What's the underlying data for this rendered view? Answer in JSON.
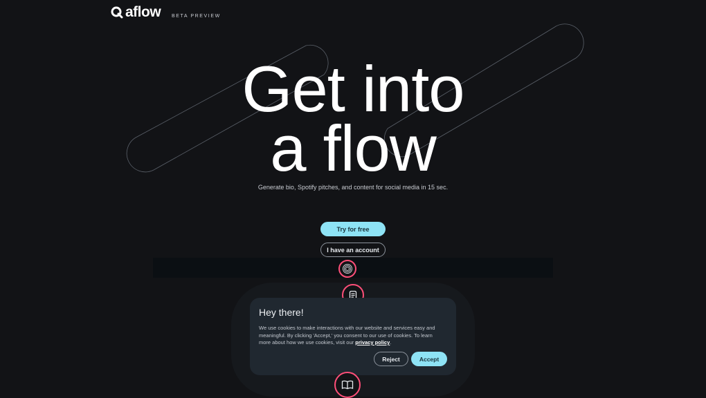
{
  "brand": {
    "name": "aflow",
    "badge": "BETA PREVIEW"
  },
  "hero": {
    "line1": "Get into",
    "line2": "a flow",
    "subtitle": "Generate bio, Spotify pitches, and content for social media in 15 sec."
  },
  "actions": {
    "primary": "Try for free",
    "secondary": "I have an account"
  },
  "steps": [
    {
      "icon": "spiral-icon"
    },
    {
      "icon": "document-icon"
    },
    {
      "icon": "book-icon"
    }
  ],
  "cookie": {
    "title": "Hey there!",
    "text_before_link": "We use cookies to make interactions with our website and services easy and meaningful. By clicking 'Accept,' you consent to our use of cookies. To learn more about how we use cookies, visit our ",
    "link": "privacy policy",
    "text_after_link": ".",
    "reject": "Reject",
    "accept": "Accept"
  },
  "colors": {
    "background": "#121316",
    "accent": "#8ee3f5",
    "ring": "#ff4f79",
    "modal": "#202830"
  }
}
